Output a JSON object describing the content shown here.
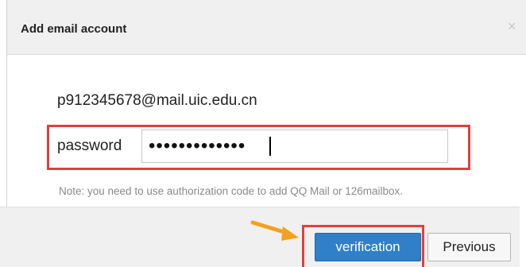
{
  "dialog": {
    "title": "Add email account",
    "close_glyph": "×",
    "email": "p912345678@mail.uic.edu.cn",
    "password_label": "password",
    "password_value": "•••••••••••••",
    "note": "Note: you need to use authorization code to add QQ Mail or 126mailbox.",
    "verify_label": "verification",
    "previous_label": "Previous"
  },
  "icons": {
    "close": "close-icon",
    "arrow": "arrow-right-icon"
  },
  "colors": {
    "primary": "#2f7fc9",
    "highlight": "#e04040",
    "arrow": "#f5a01e",
    "header_bg": "#f0f0f0"
  }
}
